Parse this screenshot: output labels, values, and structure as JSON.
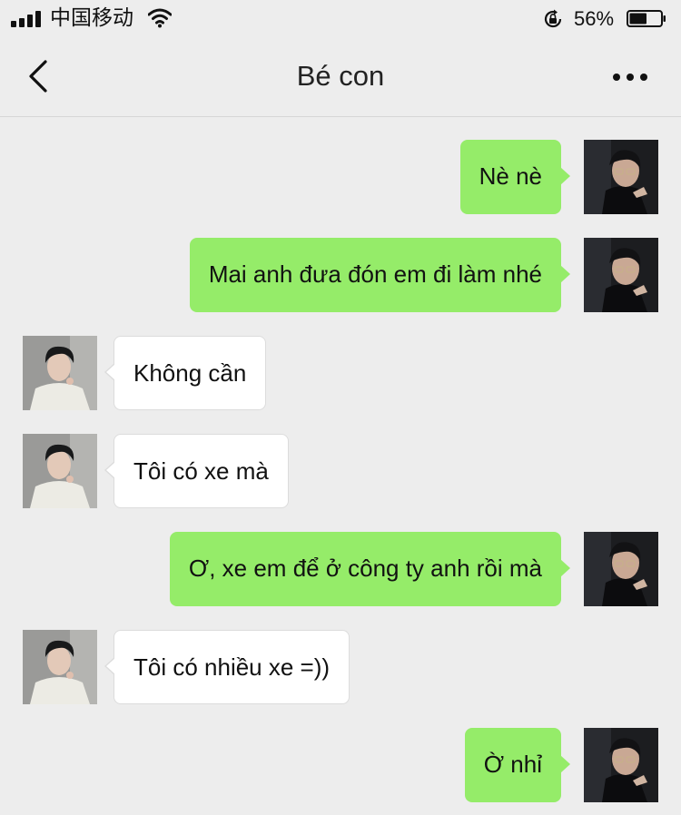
{
  "status_bar": {
    "carrier": "中国移动",
    "battery_percent_text": "56%",
    "battery_level": 0.56,
    "icons": [
      "signal-icon",
      "wifi-icon",
      "rotation-lock-icon",
      "battery-icon"
    ]
  },
  "header": {
    "title": "Bé con",
    "back_icon": "chevron-left-icon",
    "more_icon": "more-dots-icon"
  },
  "colors": {
    "background": "#ededed",
    "outgoing_bubble": "#95ec69",
    "incoming_bubble": "#ffffff"
  },
  "messages": [
    {
      "direction": "outgoing",
      "text": "Nè nè"
    },
    {
      "direction": "outgoing",
      "text": "Mai anh đưa đón em đi làm nhé"
    },
    {
      "direction": "incoming",
      "text": "Không cần"
    },
    {
      "direction": "incoming",
      "text": "Tôi có xe mà"
    },
    {
      "direction": "outgoing",
      "text": "Ơ, xe em để ở công ty anh rồi mà"
    },
    {
      "direction": "incoming",
      "text": "Tôi có nhiều xe =))"
    },
    {
      "direction": "outgoing",
      "text": "Ờ nhỉ"
    }
  ]
}
